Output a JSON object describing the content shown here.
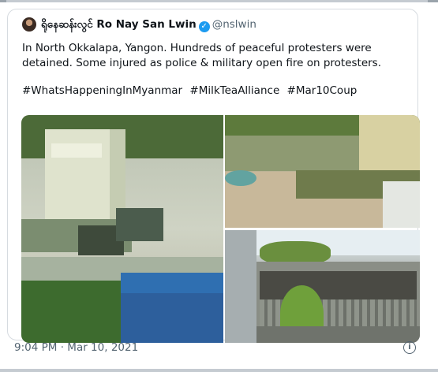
{
  "tweet": {
    "author_name": "ရိုနေဆန်းလွင် Ro Nay San Lwin",
    "handle": "@nslwin",
    "text": "In North Okkalapa, Yangon. Hundreds of peaceful protesters were detained. Some injured as police & military open fire on protesters.",
    "hashtags": [
      "#WhatsHappeningInMyanmar",
      "#MilkTeaAlliance",
      "#Mar10Coup"
    ],
    "time": "9:04 PM",
    "separator": "·",
    "date": "Mar 10, 2021"
  },
  "icons": {
    "verified": "verified-badge-icon",
    "info": "info-icon"
  },
  "colors": {
    "link_blue": "#1d9bf0",
    "text": "#0f1419",
    "muted": "#536471"
  }
}
